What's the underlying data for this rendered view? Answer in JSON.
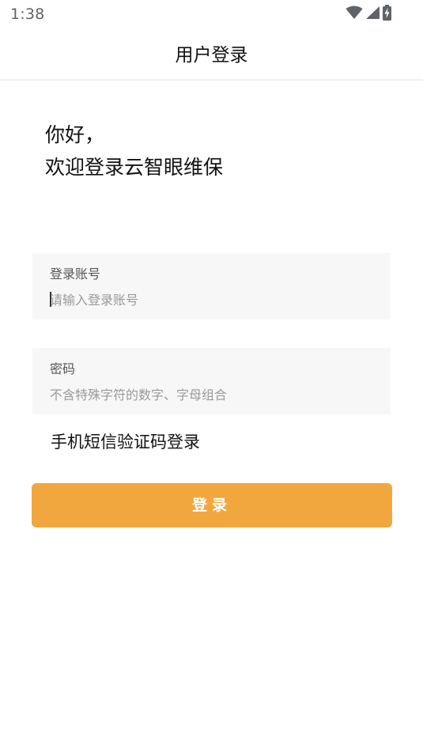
{
  "status_bar": {
    "time": "1:38",
    "icons": [
      "wifi-icon",
      "cell-signal-icon",
      "battery-charging-icon"
    ]
  },
  "header": {
    "title": "用户登录"
  },
  "greeting": {
    "line1": "你好，",
    "line2": "欢迎登录云智眼维保"
  },
  "form": {
    "account": {
      "label": "登录账号",
      "placeholder": "请输入登录账号",
      "value": ""
    },
    "password": {
      "label": "密码",
      "placeholder": "不含特殊字符的数字、字母组合",
      "value": ""
    },
    "sms_login_label": "手机短信验证码登录",
    "submit_label": "登录"
  },
  "colors": {
    "accent": "#f2a73e",
    "field_bg": "#f7f7f7",
    "status_icon": "#5f6368"
  }
}
